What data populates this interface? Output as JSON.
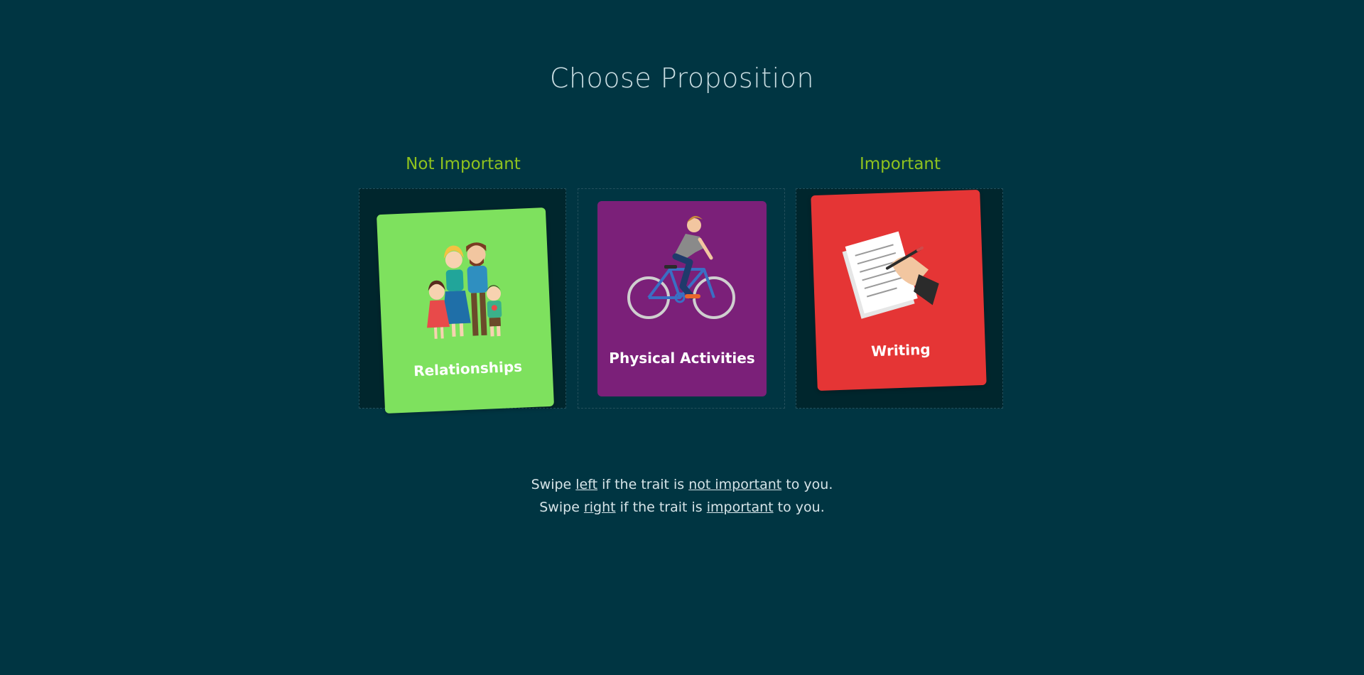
{
  "page": {
    "title": "Choose Proposition"
  },
  "zones": {
    "left_label": "Not Important",
    "right_label": "Important"
  },
  "cards": [
    {
      "label": "Relationships",
      "icon": "family-illustration",
      "color": "#7ee15e",
      "zone": "not-important"
    },
    {
      "label": "Physical Activities",
      "icon": "cyclist-illustration",
      "color": "#7b2079",
      "zone": "center"
    },
    {
      "label": "Writing",
      "icon": "writing-hand-illustration",
      "color": "#e53535",
      "zone": "important"
    }
  ],
  "instructions": {
    "line1": {
      "prefix": "Swipe ",
      "direction": "left",
      "middle": " if the trait is ",
      "emphasis": "not important",
      "suffix": " to you."
    },
    "line2": {
      "prefix": "Swipe ",
      "direction": "right",
      "middle": " if the trait is ",
      "emphasis": "important",
      "suffix": " to you."
    }
  },
  "colors": {
    "background": "#003542",
    "zone_label": "#8fc21e",
    "slot_fill": "#00262d"
  }
}
